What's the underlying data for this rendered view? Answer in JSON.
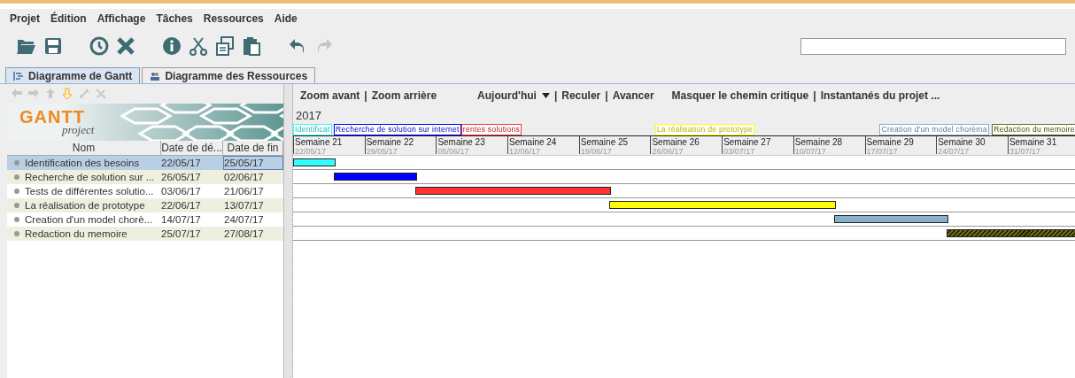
{
  "menu": [
    {
      "label": "Projet"
    },
    {
      "label": "Édition"
    },
    {
      "label": "Affichage"
    },
    {
      "label": "Tâches"
    },
    {
      "label": "Ressources"
    },
    {
      "label": "Aide"
    }
  ],
  "toolbar": [
    {
      "kind": "open",
      "disabled": false
    },
    {
      "kind": "save",
      "disabled": false
    },
    {
      "kind": "sep"
    },
    {
      "kind": "clock",
      "disabled": false
    },
    {
      "kind": "delete",
      "disabled": false
    },
    {
      "kind": "sep"
    },
    {
      "kind": "info",
      "disabled": false
    },
    {
      "kind": "cut",
      "disabled": false
    },
    {
      "kind": "copy",
      "disabled": false
    },
    {
      "kind": "paste",
      "disabled": false
    },
    {
      "kind": "sep"
    },
    {
      "kind": "undo",
      "disabled": false
    },
    {
      "kind": "redo",
      "disabled": true
    }
  ],
  "tabs": [
    {
      "label": "Diagramme de Gantt",
      "kind": "gantt",
      "selected": true
    },
    {
      "label": "Diagramme des Ressources",
      "kind": "resources",
      "selected": false
    }
  ],
  "nav": [
    {
      "kind": "left",
      "disabled": true
    },
    {
      "kind": "right",
      "disabled": true
    },
    {
      "kind": "up",
      "disabled": true
    },
    {
      "kind": "down",
      "disabled": false
    },
    {
      "kind": "link",
      "disabled": true
    },
    {
      "kind": "unlink",
      "disabled": true
    }
  ],
  "logo": {
    "name": "GANTT",
    "sub": "project"
  },
  "table": {
    "columns": [
      "Nom",
      "Date de dé...",
      "Date de fin"
    ],
    "rows": [
      {
        "name": "Identification des besoins",
        "start": "22/05/17",
        "end": "25/05/17",
        "selected": true
      },
      {
        "name": "Recherche de solution sur ...",
        "start": "26/05/17",
        "end": "02/06/17",
        "selected": false
      },
      {
        "name": "Tests de différentes solutio...",
        "start": "03/06/17",
        "end": "21/06/17",
        "selected": false
      },
      {
        "name": "La réalisation de prototype",
        "start": "22/06/17",
        "end": "13/07/17",
        "selected": false
      },
      {
        "name": "Creation d'un model chorè...",
        "start": "14/07/17",
        "end": "24/07/17",
        "selected": false
      },
      {
        "name": "Redaction du memoire",
        "start": "25/07/17",
        "end": "27/08/17",
        "selected": false
      }
    ]
  },
  "chart_toolbar": [
    {
      "label": "Zoom avant",
      "kind": "link"
    },
    {
      "label": "|",
      "kind": "sep"
    },
    {
      "label": "Zoom arrière",
      "kind": "link"
    },
    {
      "label": "Aujourd'hui",
      "kind": "dropdown"
    },
    {
      "label": "|",
      "kind": "sep"
    },
    {
      "label": "Reculer",
      "kind": "link"
    },
    {
      "label": "|",
      "kind": "sep"
    },
    {
      "label": "Avancer",
      "kind": "link"
    },
    {
      "label": "Masquer le chemin critique",
      "kind": "link"
    },
    {
      "label": "|",
      "kind": "sep"
    },
    {
      "label": "Instantanés du projet ...",
      "kind": "link"
    }
  ],
  "year": "2017",
  "bars": [
    {
      "label": "Identificat",
      "color": "#33ffff",
      "hatched": false
    },
    {
      "label": "Recherche de solution sur internet",
      "color": "#0000ff",
      "hatched": false
    },
    {
      "label": "rentes solutions",
      "color": "#ff3333",
      "hatched": false
    },
    {
      "label": "La réalisation de prototype",
      "color": "#ffff00",
      "hatched": false
    },
    {
      "label": "Creation d'un model chorèma",
      "color": "#86b0cc",
      "hatched": false
    },
    {
      "label": "Redaction du memoire",
      "color": "#6b6b1a",
      "hatched": true
    }
  ],
  "weeks": [
    {
      "label": "Semaine 21",
      "date": "22/05/17"
    },
    {
      "label": "Semaine 22",
      "date": "29/05/17"
    },
    {
      "label": "Semaine 23",
      "date": "05/06/17"
    },
    {
      "label": "Semaine 24",
      "date": "12/06/17"
    },
    {
      "label": "Semaine 25",
      "date": "19/06/17"
    },
    {
      "label": "Semaine 26",
      "date": "26/06/17"
    },
    {
      "label": "Semaine 27",
      "date": "03/07/17"
    },
    {
      "label": "Semaine 28",
      "date": "10/07/17"
    },
    {
      "label": "Semaine 29",
      "date": "17/07/17"
    },
    {
      "label": "Semaine 30",
      "date": "24/07/17"
    },
    {
      "label": "Semaine 31",
      "date": "31/07/17"
    }
  ]
}
